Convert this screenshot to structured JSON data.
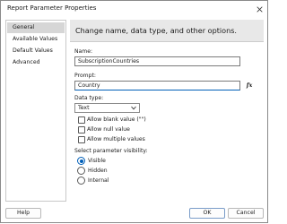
{
  "window": {
    "title": "Report Parameter Properties",
    "close_icon": "close-icon"
  },
  "sidebar": {
    "items": [
      {
        "label": "General",
        "selected": true
      },
      {
        "label": "Available Values",
        "selected": false
      },
      {
        "label": "Default Values",
        "selected": false
      },
      {
        "label": "Advanced",
        "selected": false
      }
    ]
  },
  "main": {
    "header": "Change name, data type, and other options.",
    "name": {
      "label": "Name:",
      "value": "SubscriptionCountries"
    },
    "prompt": {
      "label": "Prompt:",
      "value": "Country",
      "expression_icon": "fx-expression-icon",
      "expression_glyph": "fx"
    },
    "data_type": {
      "label": "Data type:",
      "selected": "Text"
    },
    "options": [
      {
        "label": "Allow blank value (\"\")",
        "checked": false
      },
      {
        "label": "Allow null value",
        "checked": false
      },
      {
        "label": "Allow multiple values",
        "checked": false
      }
    ],
    "visibility": {
      "label": "Select parameter visibility:",
      "options": [
        {
          "label": "Visible",
          "checked": true
        },
        {
          "label": "Hidden",
          "checked": false
        },
        {
          "label": "Internal",
          "checked": false
        }
      ]
    }
  },
  "footer": {
    "help": "Help",
    "ok": "OK",
    "cancel": "Cancel"
  },
  "colors": {
    "accent": "#005fb8",
    "header_bg": "#e8e8e8",
    "selected_item_bg": "#d6d6d6"
  }
}
